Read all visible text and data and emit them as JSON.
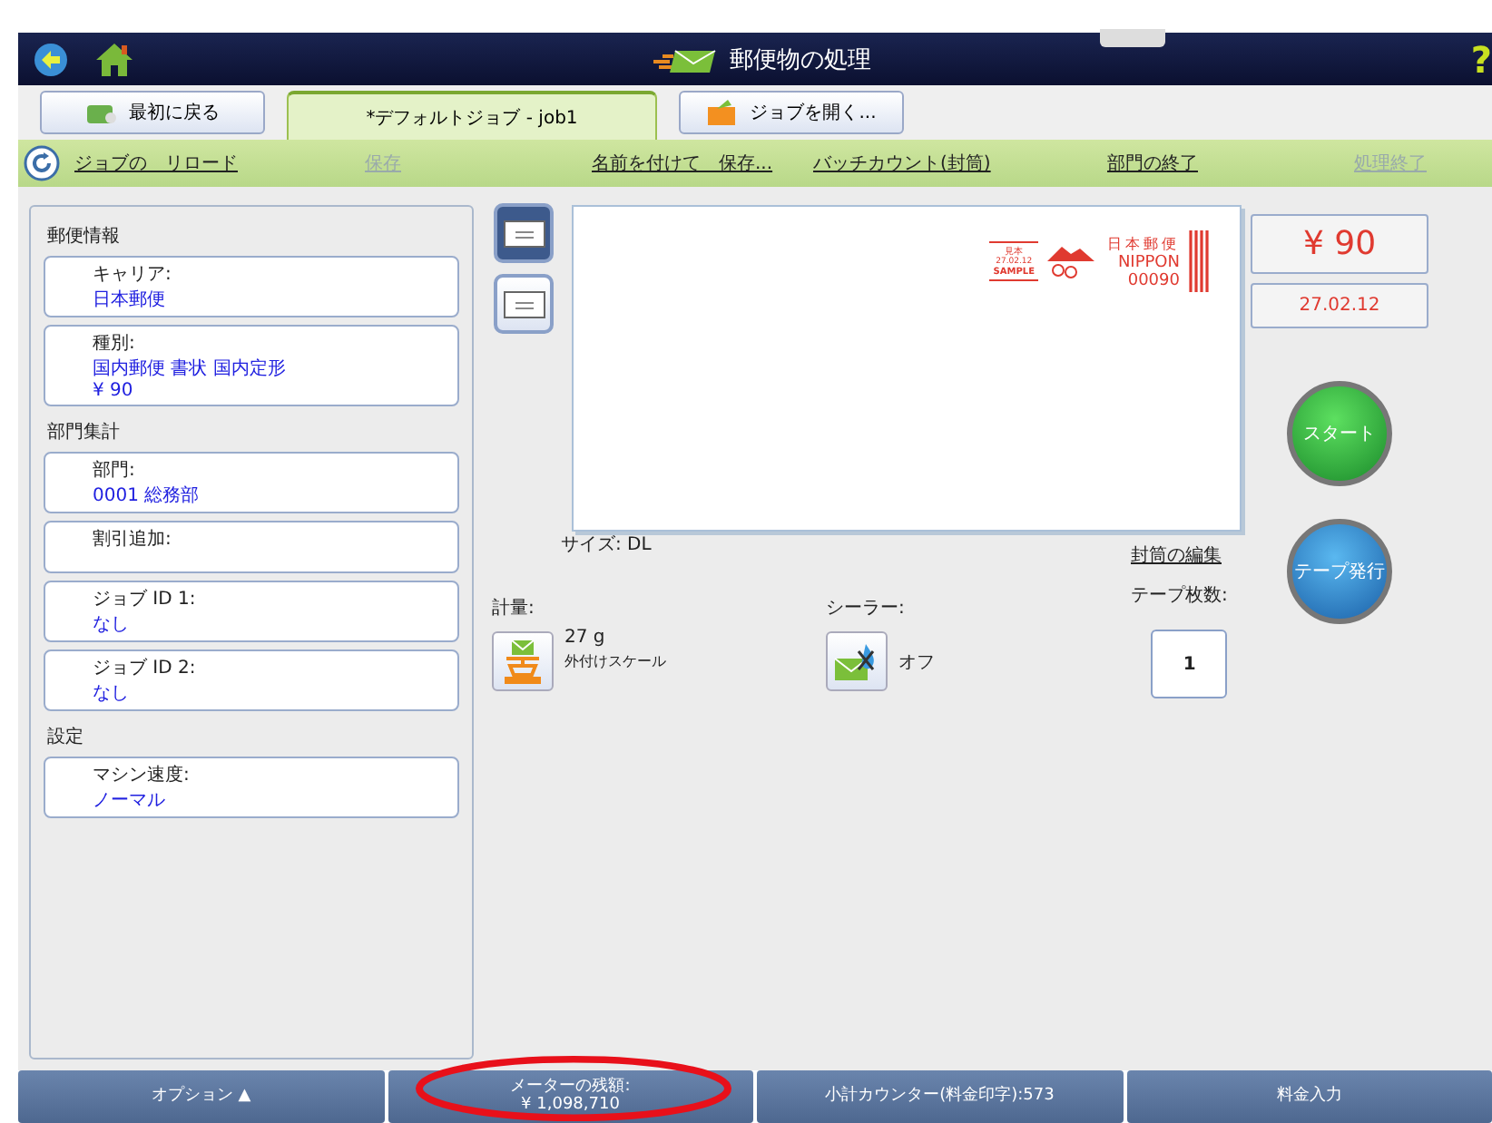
{
  "header": {
    "title": "郵便物の処理",
    "help": "?"
  },
  "tabs": [
    {
      "label": "最初に戻る",
      "selected": false,
      "kind": "home"
    },
    {
      "label": "*デフォルトジョブ - job1",
      "selected": true,
      "kind": "job"
    },
    {
      "label": "ジョブを開く...",
      "selected": false,
      "kind": "open"
    }
  ],
  "toolbar": [
    {
      "label": "ジョブの　リロード",
      "disabled": false
    },
    {
      "label": "保存",
      "disabled": true
    },
    {
      "label": "名前を付けて　保存...",
      "disabled": false
    },
    {
      "label": "バッチカウント(封筒)",
      "disabled": false
    },
    {
      "label": "部門の終了",
      "disabled": false
    },
    {
      "label": "処理終了",
      "disabled": true
    }
  ],
  "sidebar": [
    {
      "heading": "郵便情報",
      "fields": [
        {
          "label": "キャリア:",
          "values": [
            "日本郵便"
          ]
        },
        {
          "label": "種別:",
          "values": [
            "国内郵便 書状 国内定形",
            "¥ 90"
          ]
        }
      ]
    },
    {
      "heading": "部門集計",
      "fields": [
        {
          "label": "部門:",
          "values": [
            "0001 総務部"
          ]
        },
        {
          "label": "割引追加:"
        },
        {
          "label": "ジョブ ID 1:",
          "values": [
            "なし"
          ]
        },
        {
          "label": "ジョブ ID 2:",
          "values": [
            "なし"
          ]
        }
      ]
    },
    {
      "heading": "設定",
      "fields": [
        {
          "label": "マシン速度:",
          "values": [
            "ノーマル"
          ]
        }
      ]
    }
  ],
  "views": [
    {
      "selected": true
    },
    {
      "selected": false
    }
  ],
  "stamp": {
    "mark": "見本",
    "date": "27.02.12",
    "sample": "SAMPLE",
    "carrier": "日本郵便",
    "country": "NIPPON",
    "amount": "00090"
  },
  "size": "サイズ: DL",
  "edit_link": "封筒の編集",
  "scale": {
    "label": "計量:",
    "weight": "27 g",
    "source": "外付けスケール"
  },
  "sealer": {
    "label": "シーラー:",
    "value": "オフ"
  },
  "tape": {
    "label": "テープ枚数:",
    "count": "1"
  },
  "price": "¥ 90",
  "date": "27.02.12",
  "start_button": "スタート",
  "tape_button": "テープ発行",
  "bottom_bar": [
    {
      "label": "オプション ▲"
    },
    {
      "label": "メーターの残額:",
      "lines": [
        "¥ 1,098,710"
      ],
      "circled": true
    },
    {
      "label": "小計カウンター(料金印字):573"
    },
    {
      "label": "料金入力"
    }
  ]
}
